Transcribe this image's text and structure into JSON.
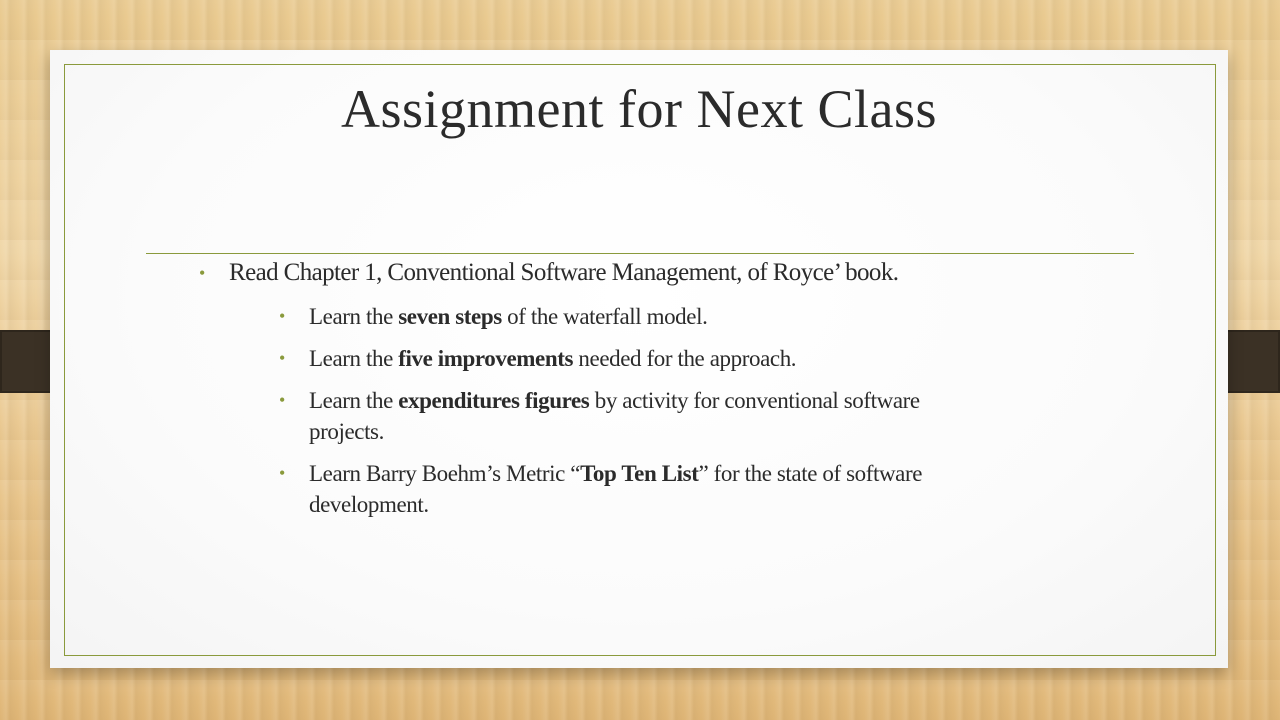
{
  "slide": {
    "title": "Assignment for Next Class",
    "bullets": {
      "main": "Read Chapter 1, Conventional Software Management, of Royce’ book.",
      "sub": [
        {
          "before": "Learn the ",
          "bold": "seven steps",
          "after": " of the waterfall model."
        },
        {
          "before": "Learn the ",
          "bold": "five improvements",
          "after": " needed for the approach."
        },
        {
          "before": "Learn the ",
          "bold": "expenditures figures",
          "after": " by activity for conventional software projects."
        },
        {
          "before": "Learn Barry Boehm’s Metric “",
          "bold": "Top Ten List",
          "after": "” for the state of software development."
        }
      ]
    },
    "bullet_symbol": "•",
    "colors": {
      "accent": "#8a9a3c",
      "text": "#2b2b2b",
      "clip": "#3b3125"
    }
  }
}
